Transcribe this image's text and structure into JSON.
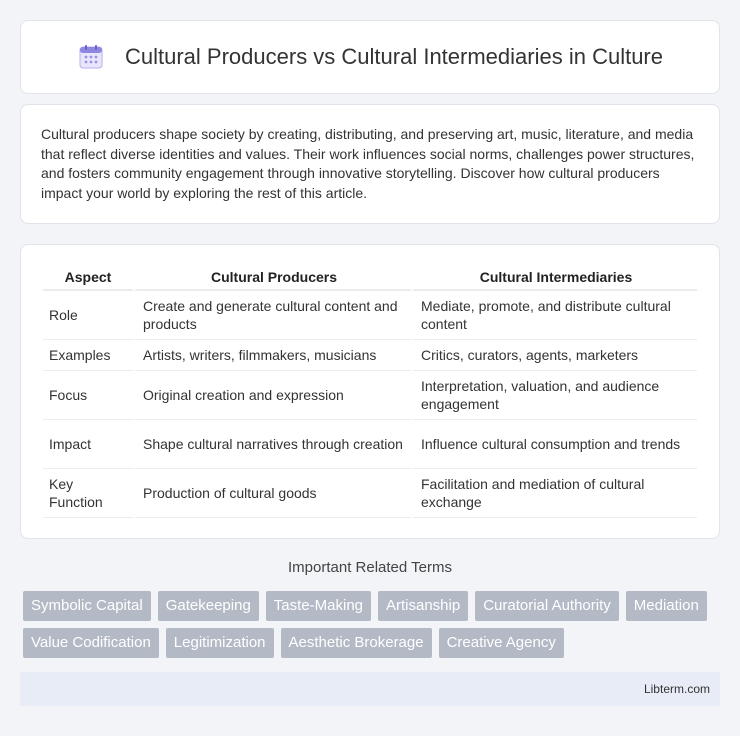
{
  "header": {
    "title": "Cultural Producers vs Cultural Intermediaries in Culture",
    "icon": "calendar-icon"
  },
  "intro": {
    "text": "Cultural producers shape society by creating, distributing, and preserving art, music, literature, and media that reflect diverse identities and values. Their work influences social norms, challenges power structures, and fosters community engagement through innovative storytelling. Discover how cultural producers impact your world by exploring the rest of this article."
  },
  "table": {
    "headers": [
      "Aspect",
      "Cultural Producers",
      "Cultural Intermediaries"
    ],
    "rows": [
      [
        "Role",
        "Create and generate cultural content and products",
        "Mediate, promote, and distribute cultural content"
      ],
      [
        "Examples",
        "Artists, writers, filmmakers, musicians",
        "Critics, curators, agents, marketers"
      ],
      [
        "Focus",
        "Original creation and expression",
        "Interpretation, valuation, and audience engagement"
      ],
      [
        "Impact",
        "Shape cultural narratives through creation",
        "Influence cultural consumption and trends"
      ],
      [
        "Key Function",
        "Production of cultural goods",
        "Facilitation and mediation of cultural exchange"
      ]
    ]
  },
  "related": {
    "title": "Important Related Terms",
    "tags": [
      "Symbolic Capital",
      "Gatekeeping",
      "Taste-Making",
      "Artisanship",
      "Curatorial Authority",
      "Mediation",
      "Value Codification",
      "Legitimization",
      "Aesthetic Brokerage",
      "Creative Agency"
    ]
  },
  "footer": {
    "brand": "Libterm.com"
  },
  "colors": {
    "tag_bg": "#b3bac6",
    "footer_bg": "#e8ecf6",
    "icon_accent": "#7b6fd6"
  }
}
